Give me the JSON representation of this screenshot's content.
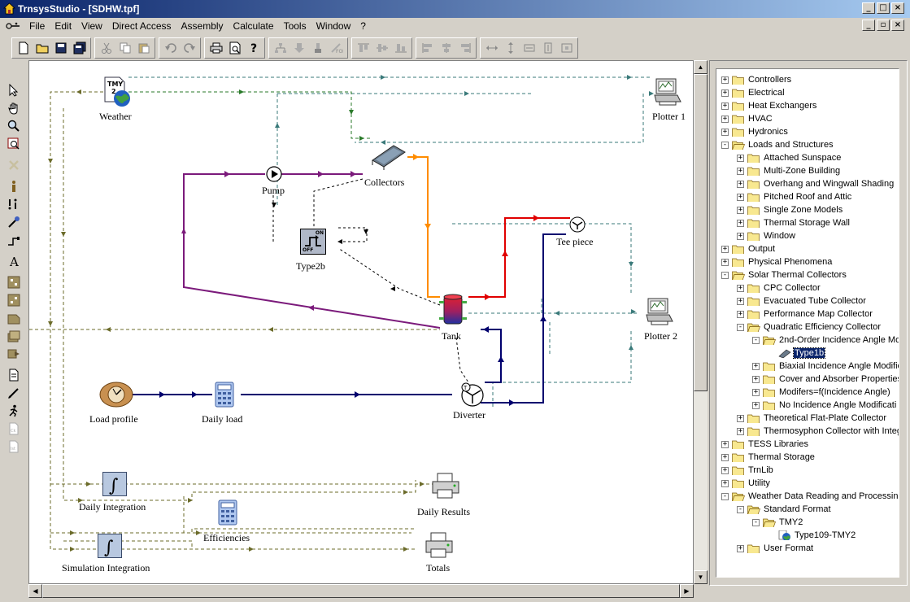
{
  "window": {
    "title": "TrnsysStudio - [SDHW.tpf]"
  },
  "menu": [
    "File",
    "Edit",
    "View",
    "Direct Access",
    "Assembly",
    "Calculate",
    "Tools",
    "Window",
    "?"
  ],
  "components": {
    "weather": "Weather",
    "plotter1": "Plotter 1",
    "pump": "Pump",
    "collectors": "Collectors",
    "type2b": "Type2b",
    "tee_piece": "Tee piece",
    "plotter2": "Plotter 2",
    "tank": "Tank",
    "load_profile": "Load profile",
    "daily_load": "Daily load",
    "diverter": "Diverter",
    "daily_integration": "Daily Integration",
    "daily_results": "Daily Results",
    "efficiencies": "Efficiencies",
    "simulation_integration": "Simulation Integration",
    "totals": "Totals"
  },
  "type2b_icon": {
    "on": "ON",
    "off": "OFF"
  },
  "tree": [
    {
      "label": "Controllers",
      "level": 0,
      "exp": "+"
    },
    {
      "label": "Electrical",
      "level": 0,
      "exp": "+"
    },
    {
      "label": "Heat Exchangers",
      "level": 0,
      "exp": "+"
    },
    {
      "label": "HVAC",
      "level": 0,
      "exp": "+"
    },
    {
      "label": "Hydronics",
      "level": 0,
      "exp": "+"
    },
    {
      "label": "Loads and Structures",
      "level": 0,
      "exp": "-",
      "open": true
    },
    {
      "label": "Attached Sunspace",
      "level": 1,
      "exp": "+"
    },
    {
      "label": "Multi-Zone Building",
      "level": 1,
      "exp": "+"
    },
    {
      "label": "Overhang and Wingwall Shading",
      "level": 1,
      "exp": "+"
    },
    {
      "label": "Pitched Roof and Attic",
      "level": 1,
      "exp": "+"
    },
    {
      "label": "Single Zone Models",
      "level": 1,
      "exp": "+"
    },
    {
      "label": "Thermal Storage Wall",
      "level": 1,
      "exp": "+"
    },
    {
      "label": "Window",
      "level": 1,
      "exp": "+"
    },
    {
      "label": "Output",
      "level": 0,
      "exp": "+"
    },
    {
      "label": "Physical Phenomena",
      "level": 0,
      "exp": "+"
    },
    {
      "label": "Solar Thermal Collectors",
      "level": 0,
      "exp": "-",
      "open": true
    },
    {
      "label": "CPC Collector",
      "level": 1,
      "exp": "+"
    },
    {
      "label": "Evacuated Tube Collector",
      "level": 1,
      "exp": "+"
    },
    {
      "label": "Performance Map Collector",
      "level": 1,
      "exp": "+"
    },
    {
      "label": "Quadratic Efficiency Collector",
      "level": 1,
      "exp": "-",
      "open": true
    },
    {
      "label": "2nd-Order Incidence Angle Mo",
      "level": 2,
      "exp": "-",
      "open": true
    },
    {
      "label": "Type1b",
      "level": 3,
      "exp": "",
      "leaf": "collector",
      "selected": true
    },
    {
      "label": "Biaxial Incidence Angle Modifie",
      "level": 2,
      "exp": "+"
    },
    {
      "label": "Cover and Absorber Properties",
      "level": 2,
      "exp": "+"
    },
    {
      "label": "Modifers=f(Incidence Angle)",
      "level": 2,
      "exp": "+"
    },
    {
      "label": "No Incidence Angle Modificati",
      "level": 2,
      "exp": "+"
    },
    {
      "label": "Theoretical Flat-Plate Collector",
      "level": 1,
      "exp": "+"
    },
    {
      "label": "Thermosyphon Collector with Integ",
      "level": 1,
      "exp": "+"
    },
    {
      "label": "TESS Libraries",
      "level": 0,
      "exp": "+"
    },
    {
      "label": "Thermal Storage",
      "level": 0,
      "exp": "+"
    },
    {
      "label": "TrnLib",
      "level": 0,
      "exp": "+"
    },
    {
      "label": "Utility",
      "level": 0,
      "exp": "+"
    },
    {
      "label": "Weather Data Reading and Processin",
      "level": 0,
      "exp": "-",
      "open": true
    },
    {
      "label": "Standard Format",
      "level": 1,
      "exp": "-",
      "open": true
    },
    {
      "label": "TMY2",
      "level": 2,
      "exp": "-",
      "open": true
    },
    {
      "label": "Type109-TMY2",
      "level": 3,
      "exp": "",
      "leaf": "globe"
    },
    {
      "label": "User Format",
      "level": 1,
      "exp": "+"
    }
  ],
  "colors": {
    "purple": "#7b1a7b",
    "orange": "#ff8c00",
    "red": "#e00000",
    "navy": "#00006e",
    "olive_dash": "#6b6b2a",
    "teal_dash": "#3a7a7a",
    "green_dash": "#2a7a2a",
    "black_dash": "#000000"
  }
}
